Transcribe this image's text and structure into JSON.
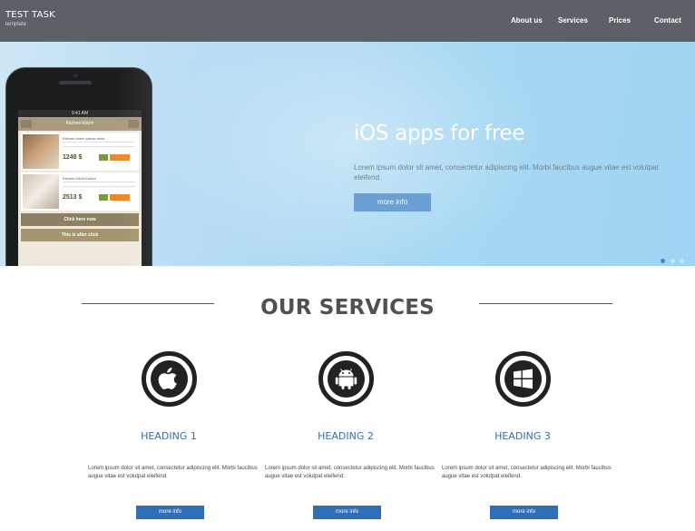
{
  "header": {
    "logo_title": "TEST TASK",
    "logo_subtitle": "template",
    "nav": [
      "About us",
      "Services",
      "Prices",
      "Contact"
    ]
  },
  "hero": {
    "title": "iOS apps for free",
    "text": "Lorem ipsum dolor sit amet, consectetur adipiscing elit. Morbi faucibus augue vitae est volutpat eleifend.",
    "button": "more info",
    "phone": {
      "status_time": "9:41 AM",
      "app_title": "Kitchen Kitchi",
      "items": [
        {
          "title": "Kitchen lorem ipsum dolor",
          "price": "1248 $"
        },
        {
          "title": "Kitchen Kitchi Kutchi",
          "price": "2513 $"
        }
      ],
      "button_primary": "Click here now",
      "button_secondary": "This is after click"
    }
  },
  "services": {
    "title": "OUR SERVICES",
    "items": [
      {
        "icon": "apple-icon",
        "heading": "HEADING 1",
        "text": "Lorem ipsum dolor sit amet, consectetur adipiscing elit. Morbi faucibus augue vitae est volutpat eleifend.",
        "button": "more info"
      },
      {
        "icon": "android-icon",
        "heading": "HEADING 2",
        "text": "Lorem ipsum dolor sit amet, consectetur adipiscing elit. Morbi faucibus augue vitae est volutpat eleifend.",
        "button": "more info"
      },
      {
        "icon": "windows-icon",
        "heading": "HEADING 3",
        "text": "Lorem ipsum dolor sit amet, consectetur adipiscing elit. Morbi faucibus augue vitae est volutpat eleifend.",
        "button": "more info"
      }
    ]
  },
  "colors": {
    "header_bg": "#5d6167",
    "hero_bg": "#a8d8f3",
    "button_blue": "#2f6eb8",
    "heading_blue": "#2f71b2"
  }
}
